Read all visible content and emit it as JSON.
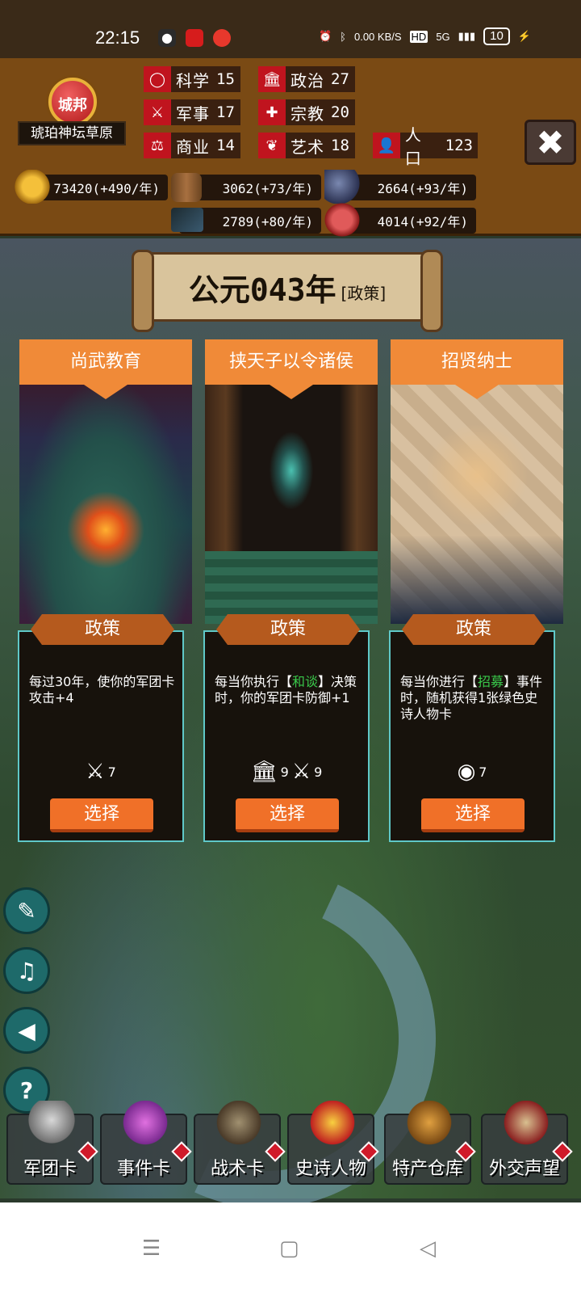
{
  "status_bar": {
    "time": "22:15",
    "net_speed": "0.00 KB/S",
    "hd": "HD",
    "signal": "5G",
    "battery": "10"
  },
  "kingdom": {
    "rank": "城邦",
    "location": "琥珀神坛草原"
  },
  "stats": [
    {
      "icon": "science-icon",
      "label": "科学",
      "value": "15"
    },
    {
      "icon": "politics-icon",
      "label": "政治",
      "value": "27"
    },
    {
      "icon": "military-icon",
      "label": "军事",
      "value": "17"
    },
    {
      "icon": "religion-icon",
      "label": "宗教",
      "value": "20"
    },
    {
      "icon": "commerce-icon",
      "label": "商业",
      "value": "14"
    },
    {
      "icon": "art-icon",
      "label": "艺术",
      "value": "18"
    },
    {
      "icon": "population-icon",
      "label": "人口",
      "value": "123"
    }
  ],
  "resources": [
    {
      "icon": "gold-icon",
      "text": "73420(+490/年)"
    },
    {
      "icon": "wood-icon",
      "text": "3062(+73/年)"
    },
    {
      "icon": "stone-icon",
      "text": "2664(+93/年)"
    },
    {
      "icon": "iron-icon",
      "text": "2789(+80/年)"
    },
    {
      "icon": "meat-icon",
      "text": "4014(+92/年)"
    }
  ],
  "year_banner": {
    "year": "公元043年",
    "tag": "[政策]"
  },
  "cards": [
    {
      "title": "尚武教育",
      "ribbon": "政策",
      "desc_parts": [
        "每过30年，使你的军团卡攻击+4",
        "",
        ""
      ],
      "cost": [
        {
          "icon": "military-icon",
          "value": "7"
        }
      ],
      "button": "选择"
    },
    {
      "title": "挟天子以令诸侯",
      "ribbon": "政策",
      "desc_parts": [
        "每当你执行【",
        "和谈",
        "】决策时，你的军团卡防御+1"
      ],
      "cost": [
        {
          "icon": "politics-icon",
          "value": "9"
        },
        {
          "icon": "military-icon",
          "value": "9"
        }
      ],
      "button": "选择"
    },
    {
      "title": "招贤纳士",
      "ribbon": "政策",
      "desc_parts": [
        "每当你进行【",
        "招募",
        "】事件时，随机获得1张绿色史诗人物卡"
      ],
      "cost": [
        {
          "icon": "science-icon",
          "value": "7"
        }
      ],
      "button": "选择"
    }
  ],
  "side_buttons": [
    "book-icon",
    "music-icon",
    "sound-icon",
    "help-icon"
  ],
  "side_glyphs": [
    "✎",
    "♫",
    "◀",
    "?"
  ],
  "nav": [
    {
      "label": "军团卡",
      "icon": "helmet-icon"
    },
    {
      "label": "事件卡",
      "icon": "scroll-icon"
    },
    {
      "label": "战术卡",
      "icon": "crossed-swords-icon"
    },
    {
      "label": "史诗人物",
      "icon": "crown-icon"
    },
    {
      "label": "特产仓库",
      "icon": "chest-icon"
    },
    {
      "label": "外交声望",
      "icon": "letter-icon"
    }
  ],
  "colors": {
    "accent_orange": "#f08a38",
    "card_border": "#5fc8c8",
    "highlight_green": "#39c84a",
    "stat_icon_red": "#c0141e"
  }
}
